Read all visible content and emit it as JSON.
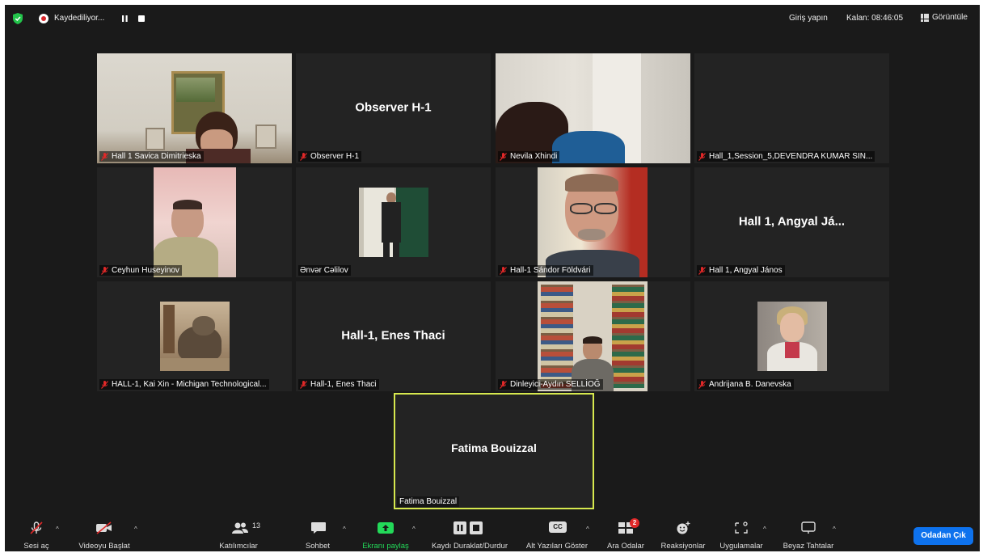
{
  "topbar": {
    "recording_label": "Kaydediliyor...",
    "sign_in": "Giriş yapın",
    "remaining": "Kalan: 08:46:05",
    "view": "Görüntüle"
  },
  "tiles": [
    {
      "name": "Hall 1 Savica Dimitrieska",
      "muted": true,
      "video": true
    },
    {
      "name": "Observer H-1",
      "display": "Observer H-1",
      "muted": true,
      "video": false
    },
    {
      "name": "Nevila Xhindi",
      "muted": true,
      "video": true
    },
    {
      "name": "Hall_1,Session_5,DEVENDRA KUMAR SIN...",
      "muted": true,
      "video": false
    },
    {
      "name": "Ceyhun Huseyinov",
      "muted": true,
      "video": true
    },
    {
      "name": "Ənvər Cəlilov",
      "muted": false,
      "video": true
    },
    {
      "name": "Hall-1 Sándor Földvári",
      "muted": true,
      "video": true
    },
    {
      "name": "Hall 1, Angyal János",
      "display": "Hall 1, Angyal Já...",
      "muted": true,
      "video": false
    },
    {
      "name": "HALL-1, Kai Xin - Michigan Technological...",
      "muted": true,
      "video": true
    },
    {
      "name": "Hall-1, Enes Thaci",
      "display": "Hall-1, Enes Thaci",
      "muted": true,
      "video": false
    },
    {
      "name": "Dinleyici-Aydın SELLİOĞ",
      "muted": true,
      "video": true
    },
    {
      "name": "Andrijana B. Danevska",
      "muted": true,
      "video": true
    }
  ],
  "speaker": {
    "display": "Fatima Bouizzal",
    "name": "Fatima Bouizzal"
  },
  "toolbar": {
    "audio": "Sesi aç",
    "video": "Videoyu Başlat",
    "participants": "Katılımcılar",
    "participants_count": "13",
    "chat": "Sohbet",
    "share": "Ekranı paylaş",
    "record": "Kaydı Duraklat/Durdur",
    "captions": "Alt Yazıları Göster",
    "breakout": "Ara Odalar",
    "breakout_badge": "2",
    "reactions": "Reaksiyonlar",
    "apps": "Uygulamalar",
    "whiteboard": "Beyaz Tahtalar",
    "leave": "Odadan Çık",
    "cc_text": "CC"
  },
  "colors": {
    "background": "#1a1a1a",
    "tile": "#232323",
    "active_speaker_border": "#d6e84e",
    "leave_button": "#0e72ed",
    "share_green": "#23d959",
    "muted_red": "#e02828"
  }
}
